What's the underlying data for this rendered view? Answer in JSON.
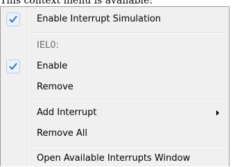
{
  "caption": "This context menu is available:",
  "menu": {
    "enable_simulation": "Enable Interrupt Simulation",
    "section_header": "IEL0:",
    "enable": "Enable",
    "remove": "Remove",
    "add_interrupt": "Add Interrupt",
    "remove_all": "Remove All",
    "open_window": "Open Available Interrupts Window"
  },
  "icons": {
    "check": "checkmark-icon",
    "submenu": "submenu-arrow-icon"
  },
  "colors": {
    "menu_background": "#f0f0f0",
    "check_color": "#1f5fb4",
    "disabled_text": "#6d6d6d"
  }
}
